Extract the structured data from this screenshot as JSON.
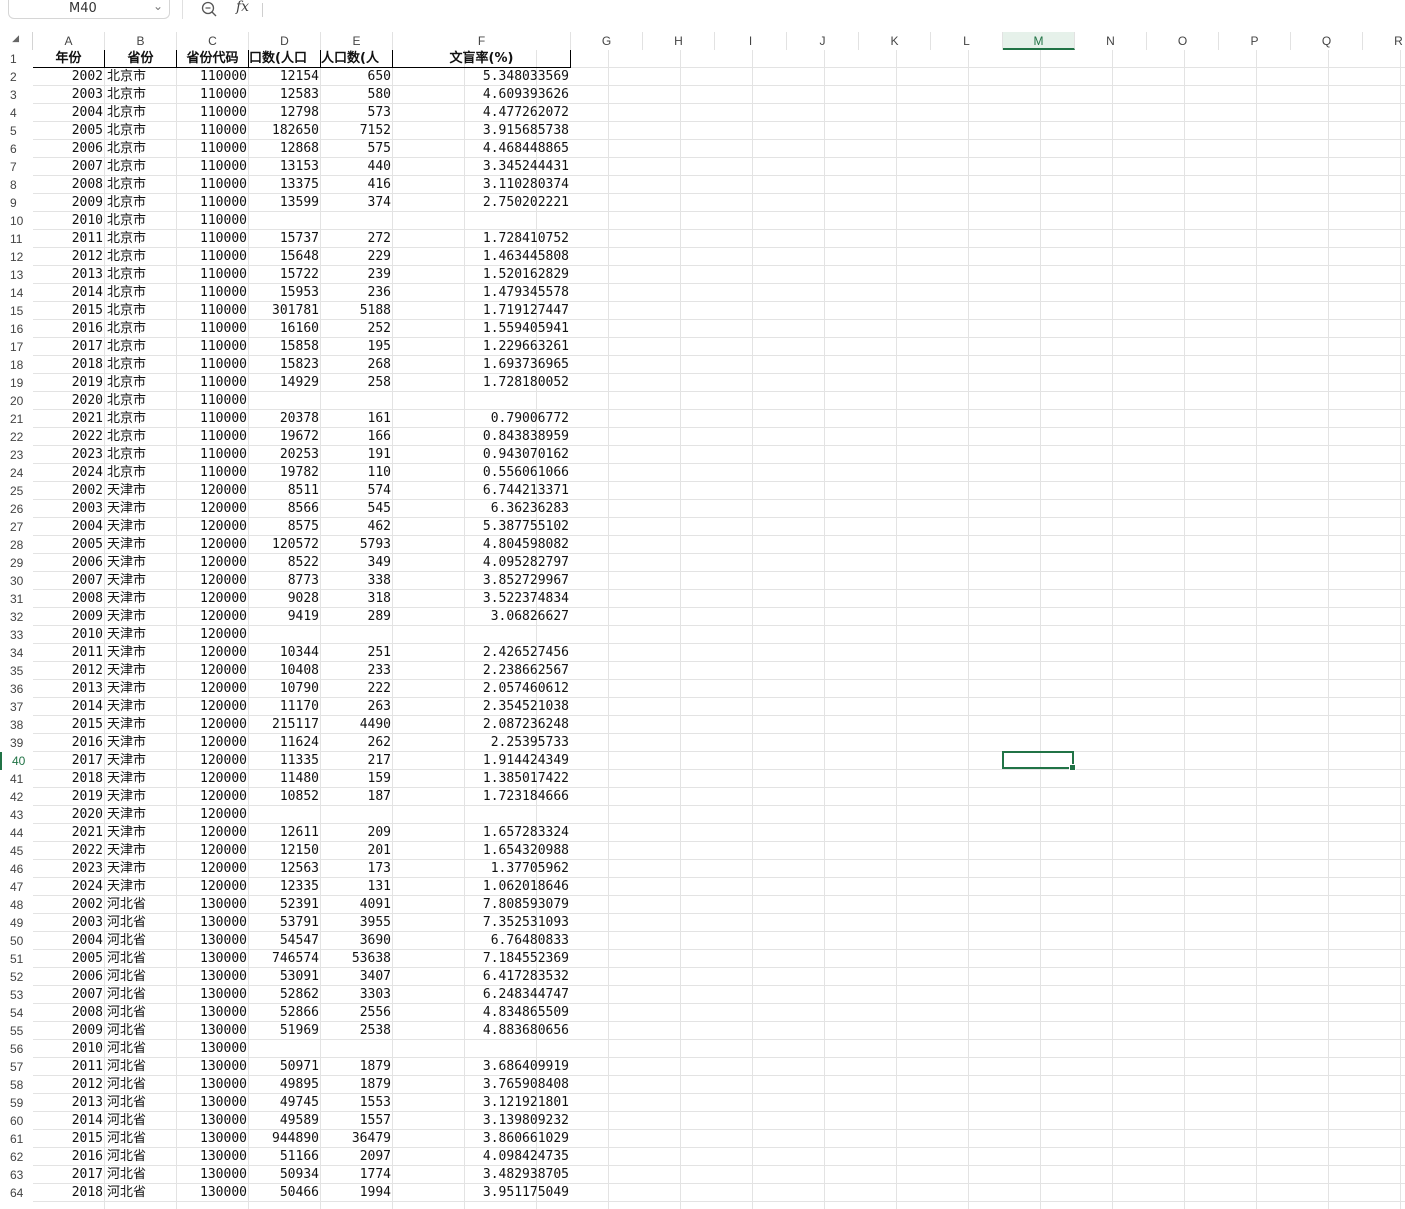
{
  "name_box": "M40",
  "formula_icon": "fx",
  "formula_value": "",
  "columns": [
    "A",
    "B",
    "C",
    "D",
    "E",
    "F",
    "G",
    "H",
    "I",
    "J",
    "K",
    "L",
    "M",
    "N",
    "O",
    "P",
    "Q",
    "R"
  ],
  "active_column": "M",
  "active_row": 40,
  "header_row": {
    "a": "年份",
    "b": "省份",
    "c": "省份代码",
    "d": "口数(人口",
    "e": "人口数(人",
    "f": "文盲率(%)"
  },
  "rows": [
    [
      "2002",
      "北京市",
      "110000",
      "12154",
      "650",
      "5.348033569"
    ],
    [
      "2003",
      "北京市",
      "110000",
      "12583",
      "580",
      "4.609393626"
    ],
    [
      "2004",
      "北京市",
      "110000",
      "12798",
      "573",
      "4.477262072"
    ],
    [
      "2005",
      "北京市",
      "110000",
      "182650",
      "7152",
      "3.915685738"
    ],
    [
      "2006",
      "北京市",
      "110000",
      "12868",
      "575",
      "4.468448865"
    ],
    [
      "2007",
      "北京市",
      "110000",
      "13153",
      "440",
      "3.345244431"
    ],
    [
      "2008",
      "北京市",
      "110000",
      "13375",
      "416",
      "3.110280374"
    ],
    [
      "2009",
      "北京市",
      "110000",
      "13599",
      "374",
      "2.750202221"
    ],
    [
      "2010",
      "北京市",
      "110000",
      "",
      "",
      ""
    ],
    [
      "2011",
      "北京市",
      "110000",
      "15737",
      "272",
      "1.728410752"
    ],
    [
      "2012",
      "北京市",
      "110000",
      "15648",
      "229",
      "1.463445808"
    ],
    [
      "2013",
      "北京市",
      "110000",
      "15722",
      "239",
      "1.520162829"
    ],
    [
      "2014",
      "北京市",
      "110000",
      "15953",
      "236",
      "1.479345578"
    ],
    [
      "2015",
      "北京市",
      "110000",
      "301781",
      "5188",
      "1.719127447"
    ],
    [
      "2016",
      "北京市",
      "110000",
      "16160",
      "252",
      "1.559405941"
    ],
    [
      "2017",
      "北京市",
      "110000",
      "15858",
      "195",
      "1.229663261"
    ],
    [
      "2018",
      "北京市",
      "110000",
      "15823",
      "268",
      "1.693736965"
    ],
    [
      "2019",
      "北京市",
      "110000",
      "14929",
      "258",
      "1.728180052"
    ],
    [
      "2020",
      "北京市",
      "110000",
      "",
      "",
      ""
    ],
    [
      "2021",
      "北京市",
      "110000",
      "20378",
      "161",
      "0.79006772"
    ],
    [
      "2022",
      "北京市",
      "110000",
      "19672",
      "166",
      "0.843838959"
    ],
    [
      "2023",
      "北京市",
      "110000",
      "20253",
      "191",
      "0.943070162"
    ],
    [
      "2024",
      "北京市",
      "110000",
      "19782",
      "110",
      "0.556061066"
    ],
    [
      "2002",
      "天津市",
      "120000",
      "8511",
      "574",
      "6.744213371"
    ],
    [
      "2003",
      "天津市",
      "120000",
      "8566",
      "545",
      "6.36236283"
    ],
    [
      "2004",
      "天津市",
      "120000",
      "8575",
      "462",
      "5.387755102"
    ],
    [
      "2005",
      "天津市",
      "120000",
      "120572",
      "5793",
      "4.804598082"
    ],
    [
      "2006",
      "天津市",
      "120000",
      "8522",
      "349",
      "4.095282797"
    ],
    [
      "2007",
      "天津市",
      "120000",
      "8773",
      "338",
      "3.852729967"
    ],
    [
      "2008",
      "天津市",
      "120000",
      "9028",
      "318",
      "3.522374834"
    ],
    [
      "2009",
      "天津市",
      "120000",
      "9419",
      "289",
      "3.06826627"
    ],
    [
      "2010",
      "天津市",
      "120000",
      "",
      "",
      ""
    ],
    [
      "2011",
      "天津市",
      "120000",
      "10344",
      "251",
      "2.426527456"
    ],
    [
      "2012",
      "天津市",
      "120000",
      "10408",
      "233",
      "2.238662567"
    ],
    [
      "2013",
      "天津市",
      "120000",
      "10790",
      "222",
      "2.057460612"
    ],
    [
      "2014",
      "天津市",
      "120000",
      "11170",
      "263",
      "2.354521038"
    ],
    [
      "2015",
      "天津市",
      "120000",
      "215117",
      "4490",
      "2.087236248"
    ],
    [
      "2016",
      "天津市",
      "120000",
      "11624",
      "262",
      "2.25395733"
    ],
    [
      "2017",
      "天津市",
      "120000",
      "11335",
      "217",
      "1.914424349"
    ],
    [
      "2018",
      "天津市",
      "120000",
      "11480",
      "159",
      "1.385017422"
    ],
    [
      "2019",
      "天津市",
      "120000",
      "10852",
      "187",
      "1.723184666"
    ],
    [
      "2020",
      "天津市",
      "120000",
      "",
      "",
      ""
    ],
    [
      "2021",
      "天津市",
      "120000",
      "12611",
      "209",
      "1.657283324"
    ],
    [
      "2022",
      "天津市",
      "120000",
      "12150",
      "201",
      "1.654320988"
    ],
    [
      "2023",
      "天津市",
      "120000",
      "12563",
      "173",
      "1.37705962"
    ],
    [
      "2024",
      "天津市",
      "120000",
      "12335",
      "131",
      "1.062018646"
    ],
    [
      "2002",
      "河北省",
      "130000",
      "52391",
      "4091",
      "7.808593079"
    ],
    [
      "2003",
      "河北省",
      "130000",
      "53791",
      "3955",
      "7.352531093"
    ],
    [
      "2004",
      "河北省",
      "130000",
      "54547",
      "3690",
      "6.76480833"
    ],
    [
      "2005",
      "河北省",
      "130000",
      "746574",
      "53638",
      "7.184552369"
    ],
    [
      "2006",
      "河北省",
      "130000",
      "53091",
      "3407",
      "6.417283532"
    ],
    [
      "2007",
      "河北省",
      "130000",
      "52862",
      "3303",
      "6.248344747"
    ],
    [
      "2008",
      "河北省",
      "130000",
      "52866",
      "2556",
      "4.834865509"
    ],
    [
      "2009",
      "河北省",
      "130000",
      "51969",
      "2538",
      "4.883680656"
    ],
    [
      "2010",
      "河北省",
      "130000",
      "",
      "",
      ""
    ],
    [
      "2011",
      "河北省",
      "130000",
      "50971",
      "1879",
      "3.686409919"
    ],
    [
      "2012",
      "河北省",
      "130000",
      "49895",
      "1879",
      "3.765908408"
    ],
    [
      "2013",
      "河北省",
      "130000",
      "49745",
      "1553",
      "3.121921801"
    ],
    [
      "2014",
      "河北省",
      "130000",
      "49589",
      "1557",
      "3.139809232"
    ],
    [
      "2015",
      "河北省",
      "130000",
      "944890",
      "36479",
      "3.860661029"
    ],
    [
      "2016",
      "河北省",
      "130000",
      "51166",
      "2097",
      "4.098424735"
    ],
    [
      "2017",
      "河北省",
      "130000",
      "50934",
      "1774",
      "3.482938705"
    ],
    [
      "2018",
      "河北省",
      "130000",
      "50466",
      "1994",
      "3.951175049"
    ]
  ]
}
